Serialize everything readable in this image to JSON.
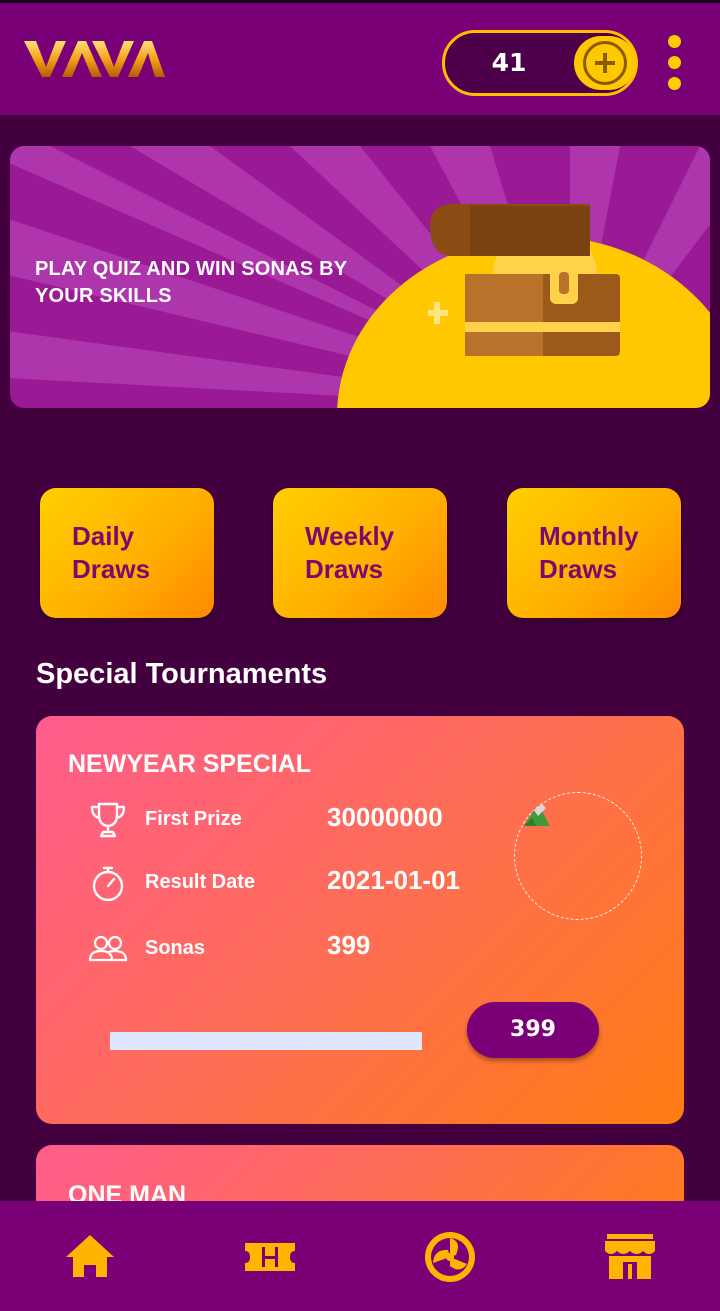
{
  "header": {
    "logo_text": "VAVA",
    "coin_balance": "41",
    "add_coin_icon": "plus-circle-icon",
    "menu_icon": "vertical-dots-icon"
  },
  "banner": {
    "text": "PLAY QUIZ AND WIN SONAS BY YOUR SKILLS",
    "image_icon": "treasure-chest-icon"
  },
  "draws": [
    {
      "label": "Daily Draws"
    },
    {
      "label": "Weekly Draws"
    },
    {
      "label": "Monthly Draws"
    }
  ],
  "section_title": "Special Tournaments",
  "tournaments": [
    {
      "title": "NEWYEAR SPECIAL",
      "rows": [
        {
          "icon": "trophy-icon",
          "label": "First Prize",
          "value": "30000000"
        },
        {
          "icon": "stopwatch-icon",
          "label": "Result Date",
          "value": "2021-01-01"
        },
        {
          "icon": "users-icon",
          "label": "Sonas",
          "value": "399"
        }
      ],
      "progress_fraction": 1.0,
      "join_label": "399"
    },
    {
      "title": "ONE MAN"
    }
  ],
  "bottom_nav": [
    {
      "icon": "home-icon",
      "active": true
    },
    {
      "icon": "ticket-icon"
    },
    {
      "icon": "spin-wheel-icon"
    },
    {
      "icon": "store-icon"
    }
  ],
  "colors": {
    "background": "#43003f",
    "header": "#7a0077",
    "accent": "#ffc800",
    "card_gradient_start": "#ff5c8d",
    "card_gradient_end": "#ff7c12",
    "draw_text": "#7a0a6e"
  }
}
